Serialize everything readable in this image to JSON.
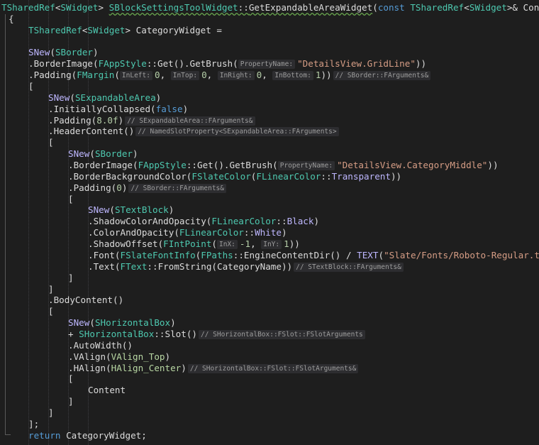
{
  "editor": {
    "lines": [
      {
        "indent": 0,
        "tokens": [
          {
            "t": "TSharedRef",
            "c": "ty"
          },
          {
            "t": "<",
            "c": "tx"
          },
          {
            "t": "SWidget",
            "c": "ty"
          },
          {
            "t": "> ",
            "c": "tx"
          },
          {
            "t": "SBlockSettingsToolWidget",
            "c": "ty",
            "u": 1
          },
          {
            "t": "::",
            "c": "tx",
            "u": 1
          },
          {
            "t": "GetExpandableAreaWidget",
            "c": "fn",
            "u": 1
          },
          {
            "t": "(",
            "c": "tx"
          },
          {
            "t": "const ",
            "c": "kw"
          },
          {
            "t": "TSharedRef",
            "c": "ty"
          },
          {
            "t": "<",
            "c": "tx"
          },
          {
            "t": "SWidget",
            "c": "ty"
          },
          {
            "t": ">& Content, ",
            "c": "tx"
          },
          {
            "t": "c",
            "c": "kw"
          }
        ]
      },
      {
        "indent": 0,
        "tokens": [
          {
            "t": "{",
            "c": "tx"
          }
        ]
      },
      {
        "indent": 1,
        "tokens": [
          {
            "t": "TSharedRef",
            "c": "ty"
          },
          {
            "t": "<",
            "c": "tx"
          },
          {
            "t": "SWidget",
            "c": "ty"
          },
          {
            "t": "> CategoryWidget =",
            "c": "tx"
          }
        ]
      },
      {
        "indent": 0,
        "tokens": []
      },
      {
        "indent": 1,
        "tokens": [
          {
            "t": "SNew",
            "c": "mc"
          },
          {
            "t": "(",
            "c": "tx"
          },
          {
            "t": "SBorder",
            "c": "ty"
          },
          {
            "t": ")",
            "c": "tx"
          }
        ]
      },
      {
        "indent": 1,
        "tokens": [
          {
            "t": ".BorderImage(",
            "c": "tx"
          },
          {
            "t": "FAppStyle",
            "c": "ty"
          },
          {
            "t": "::Get().GetBrush(",
            "c": "tx"
          },
          {
            "h": "PropertyName:"
          },
          {
            "t": "\"DetailsView.GridLine\"",
            "c": "st"
          },
          {
            "t": "))",
            "c": "tx"
          }
        ]
      },
      {
        "indent": 1,
        "tokens": [
          {
            "t": ".Padding(",
            "c": "tx"
          },
          {
            "t": "FMargin",
            "c": "ty"
          },
          {
            "t": "(",
            "c": "tx"
          },
          {
            "h": "InLeft:"
          },
          {
            "t": "0",
            "c": "nm"
          },
          {
            "t": ", ",
            "c": "tx"
          },
          {
            "h": "InTop:"
          },
          {
            "t": "0",
            "c": "nm"
          },
          {
            "t": ", ",
            "c": "tx"
          },
          {
            "h": "InRight:"
          },
          {
            "t": "0",
            "c": "nm"
          },
          {
            "t": ", ",
            "c": "tx"
          },
          {
            "h": "InBottom:"
          },
          {
            "t": "1",
            "c": "nm"
          },
          {
            "t": "))",
            "c": "tx"
          },
          {
            "h": "// SBorder::FArguments&",
            "trail": 1
          }
        ]
      },
      {
        "indent": 1,
        "tokens": [
          {
            "t": "[",
            "c": "tx"
          }
        ]
      },
      {
        "indent": 2,
        "tokens": [
          {
            "t": "SNew",
            "c": "mc"
          },
          {
            "t": "(",
            "c": "tx"
          },
          {
            "t": "SExpandableArea",
            "c": "ty"
          },
          {
            "t": ")",
            "c": "tx"
          }
        ]
      },
      {
        "indent": 2,
        "tokens": [
          {
            "t": ".InitiallyCollapsed(",
            "c": "tx"
          },
          {
            "t": "false",
            "c": "kw"
          },
          {
            "t": ")",
            "c": "tx"
          }
        ]
      },
      {
        "indent": 2,
        "tokens": [
          {
            "t": ".Padding(",
            "c": "tx"
          },
          {
            "t": "8.0f",
            "c": "nm"
          },
          {
            "t": ")",
            "c": "tx"
          },
          {
            "h": "// SExpandableArea::FArguments&",
            "trail": 1
          }
        ]
      },
      {
        "indent": 2,
        "tokens": [
          {
            "t": ".HeaderContent()",
            "c": "tx"
          },
          {
            "h": "// NamedSlotProperty<SExpandableArea::FArguments>",
            "trail": 1
          }
        ]
      },
      {
        "indent": 2,
        "tokens": [
          {
            "t": "[",
            "c": "tx"
          }
        ]
      },
      {
        "indent": 3,
        "tokens": [
          {
            "t": "SNew",
            "c": "mc"
          },
          {
            "t": "(",
            "c": "tx"
          },
          {
            "t": "SBorder",
            "c": "ty"
          },
          {
            "t": ")",
            "c": "tx"
          }
        ]
      },
      {
        "indent": 3,
        "tokens": [
          {
            "t": ".BorderImage(",
            "c": "tx"
          },
          {
            "t": "FAppStyle",
            "c": "ty"
          },
          {
            "t": "::Get().GetBrush(",
            "c": "tx"
          },
          {
            "h": "PropertyName:"
          },
          {
            "t": "\"DetailsView.CategoryMiddle\"",
            "c": "st"
          },
          {
            "t": "))",
            "c": "tx"
          }
        ]
      },
      {
        "indent": 3,
        "tokens": [
          {
            "t": ".BorderBackgroundColor(",
            "c": "tx"
          },
          {
            "t": "FSlateColor",
            "c": "ty"
          },
          {
            "t": "(",
            "c": "tx"
          },
          {
            "t": "FLinearColor",
            "c": "ty"
          },
          {
            "t": "::",
            "c": "tx"
          },
          {
            "t": "Transparent",
            "c": "mc"
          },
          {
            "t": "))",
            "c": "tx"
          }
        ]
      },
      {
        "indent": 3,
        "tokens": [
          {
            "t": ".Padding(",
            "c": "tx"
          },
          {
            "t": "0",
            "c": "nm"
          },
          {
            "t": ")",
            "c": "tx"
          },
          {
            "h": "// SBorder::FArguments&",
            "trail": 1
          }
        ]
      },
      {
        "indent": 3,
        "tokens": [
          {
            "t": "[",
            "c": "tx"
          }
        ]
      },
      {
        "indent": 4,
        "tokens": [
          {
            "t": "SNew",
            "c": "mc"
          },
          {
            "t": "(",
            "c": "tx"
          },
          {
            "t": "STextBlock",
            "c": "ty"
          },
          {
            "t": ")",
            "c": "tx"
          }
        ]
      },
      {
        "indent": 4,
        "tokens": [
          {
            "t": ".ShadowColorAndOpacity(",
            "c": "tx"
          },
          {
            "t": "FLinearColor",
            "c": "ty"
          },
          {
            "t": "::",
            "c": "tx"
          },
          {
            "t": "Black",
            "c": "mc"
          },
          {
            "t": ")",
            "c": "tx"
          }
        ]
      },
      {
        "indent": 4,
        "tokens": [
          {
            "t": ".ColorAndOpacity(",
            "c": "tx"
          },
          {
            "t": "FLinearColor",
            "c": "ty"
          },
          {
            "t": "::",
            "c": "tx"
          },
          {
            "t": "White",
            "c": "mc"
          },
          {
            "t": ")",
            "c": "tx"
          }
        ]
      },
      {
        "indent": 4,
        "tokens": [
          {
            "t": ".ShadowOffset(",
            "c": "tx"
          },
          {
            "t": "FIntPoint",
            "c": "ty"
          },
          {
            "t": "(",
            "c": "tx"
          },
          {
            "h": "InX:"
          },
          {
            "t": "-1",
            "c": "nm"
          },
          {
            "t": ", ",
            "c": "tx"
          },
          {
            "h": "InY:"
          },
          {
            "t": "1",
            "c": "nm"
          },
          {
            "t": "))",
            "c": "tx"
          }
        ]
      },
      {
        "indent": 4,
        "tokens": [
          {
            "t": ".Font(",
            "c": "tx"
          },
          {
            "t": "FSlateFontInfo",
            "c": "ty"
          },
          {
            "t": "(",
            "c": "tx"
          },
          {
            "t": "FPaths",
            "c": "ty"
          },
          {
            "t": "::EngineContentDir() / ",
            "c": "tx"
          },
          {
            "t": "TEXT",
            "c": "mc"
          },
          {
            "t": "(",
            "c": "tx"
          },
          {
            "t": "\"Slate/Fonts/Roboto-Regular.ttf\"",
            "c": "st"
          },
          {
            "t": "),",
            "c": "tx"
          }
        ]
      },
      {
        "indent": 4,
        "tokens": [
          {
            "t": ".Text(",
            "c": "tx"
          },
          {
            "t": "FText",
            "c": "ty"
          },
          {
            "t": "::FromString(CategoryName))",
            "c": "tx"
          },
          {
            "h": "// STextBlock::FArguments&",
            "trail": 1
          }
        ]
      },
      {
        "indent": 3,
        "tokens": [
          {
            "t": "]",
            "c": "tx"
          }
        ]
      },
      {
        "indent": 2,
        "tokens": [
          {
            "t": "]",
            "c": "tx"
          }
        ]
      },
      {
        "indent": 2,
        "tokens": [
          {
            "t": ".BodyContent()",
            "c": "tx"
          }
        ]
      },
      {
        "indent": 2,
        "tokens": [
          {
            "t": "[",
            "c": "tx"
          }
        ]
      },
      {
        "indent": 3,
        "tokens": [
          {
            "t": "SNew",
            "c": "mc"
          },
          {
            "t": "(",
            "c": "tx"
          },
          {
            "t": "SHorizontalBox",
            "c": "ty"
          },
          {
            "t": ")",
            "c": "tx"
          }
        ]
      },
      {
        "indent": 3,
        "tokens": [
          {
            "t": "+ ",
            "c": "tx"
          },
          {
            "t": "SHorizontalBox",
            "c": "ty"
          },
          {
            "t": "::Slot()",
            "c": "tx"
          },
          {
            "h": "// SHorizontalBox::FSlot::FSlotArguments",
            "trail": 1
          }
        ]
      },
      {
        "indent": 3,
        "tokens": [
          {
            "t": ".AutoWidth()",
            "c": "tx"
          }
        ]
      },
      {
        "indent": 3,
        "tokens": [
          {
            "t": ".VAlign(",
            "c": "tx"
          },
          {
            "t": "VAlign_Top",
            "c": "en"
          },
          {
            "t": ")",
            "c": "tx"
          }
        ]
      },
      {
        "indent": 3,
        "tokens": [
          {
            "t": ".HAlign(",
            "c": "tx"
          },
          {
            "t": "HAlign_Center",
            "c": "en"
          },
          {
            "t": ")",
            "c": "tx"
          },
          {
            "h": "// SHorizontalBox::FSlot::FSlotArguments&",
            "trail": 1
          }
        ]
      },
      {
        "indent": 3,
        "tokens": [
          {
            "t": "[",
            "c": "tx"
          }
        ]
      },
      {
        "indent": 4,
        "tokens": [
          {
            "t": "Content",
            "c": "tx"
          }
        ]
      },
      {
        "indent": 3,
        "tokens": [
          {
            "t": "]",
            "c": "tx"
          }
        ]
      },
      {
        "indent": 2,
        "tokens": [
          {
            "t": "]",
            "c": "tx"
          }
        ]
      },
      {
        "indent": 1,
        "tokens": [
          {
            "t": "];",
            "c": "tx"
          }
        ]
      },
      {
        "indent": 1,
        "tokens": [
          {
            "t": "return ",
            "c": "kw"
          },
          {
            "t": "CategoryWidget;",
            "c": "tx"
          }
        ]
      }
    ]
  }
}
